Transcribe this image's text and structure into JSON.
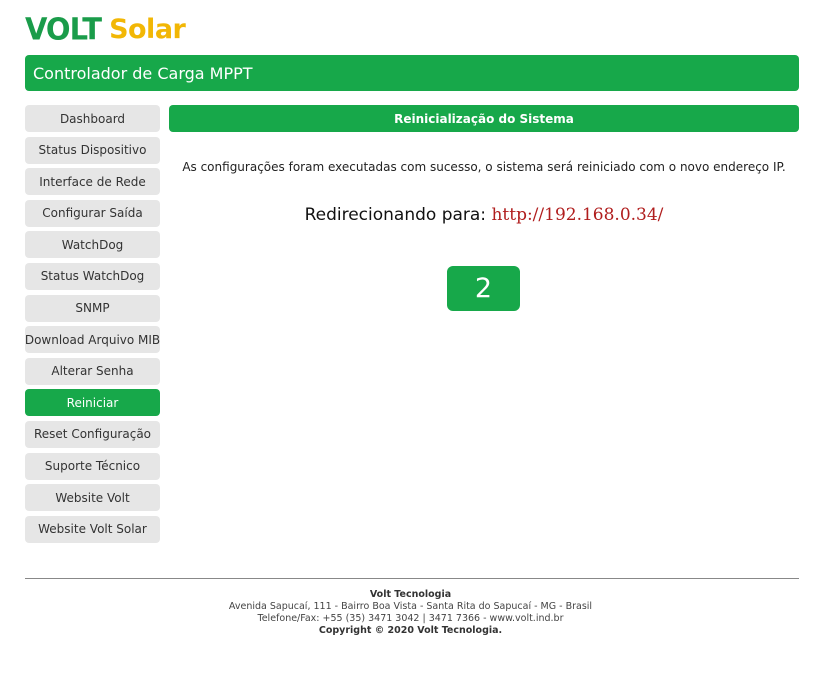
{
  "logo": {
    "part1": "VOLT",
    "part2": "Solar"
  },
  "header": {
    "title": "Controlador de Carga MPPT"
  },
  "sidebar": {
    "items": [
      {
        "label": "Dashboard"
      },
      {
        "label": "Status Dispositivo"
      },
      {
        "label": "Interface de Rede"
      },
      {
        "label": "Configurar Saída"
      },
      {
        "label": "WatchDog"
      },
      {
        "label": "Status WatchDog"
      },
      {
        "label": "SNMP"
      },
      {
        "label": "Download Arquivo MIB"
      },
      {
        "label": "Alterar Senha"
      },
      {
        "label": "Reiniciar"
      },
      {
        "label": "Reset Configuração"
      },
      {
        "label": "Suporte Técnico"
      },
      {
        "label": "Website Volt"
      },
      {
        "label": "Website Volt Solar"
      }
    ],
    "active_label": "Reiniciar"
  },
  "main": {
    "section_title": "Reinicialização do Sistema",
    "message": "As configurações foram executadas com sucesso, o sistema será reiniciado com o novo endereço IP.",
    "redirect_label": "Redirecionando para:",
    "redirect_url": "http://192.168.0.34/",
    "countdown": "2"
  },
  "footer": {
    "company": "Volt Tecnologia",
    "address": "Avenida Sapucaí, 111 - Bairro Boa Vista - Santa Rita do Sapucaí - MG - Brasil",
    "contact": "Telefone/Fax: +55 (35) 3471 3042 | 3471 7366 - www.volt.ind.br",
    "copyright": "Copyright © 2020 Volt Tecnologia."
  },
  "colors": {
    "brand_green": "#17a84a",
    "brand_yellow": "#f2b705",
    "link_red": "#b01d1d"
  }
}
